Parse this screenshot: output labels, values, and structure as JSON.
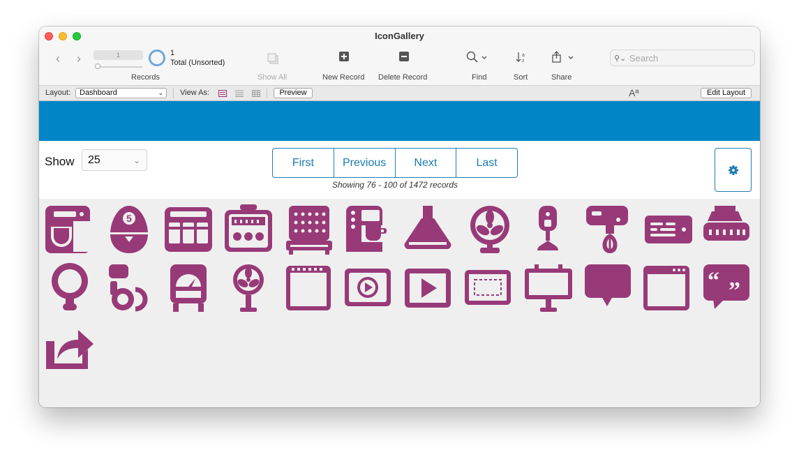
{
  "window": {
    "title": "IconGallery"
  },
  "toolbar": {
    "records_field_value": "1",
    "record_count": "1",
    "record_total": "Total (Unsorted)",
    "records_label": "Records",
    "show_all_label": "Show All",
    "new_record_label": "New Record",
    "delete_record_label": "Delete Record",
    "find_label": "Find",
    "sort_label": "Sort",
    "share_label": "Share",
    "search_placeholder": "Search"
  },
  "layout_bar": {
    "layout_label": "Layout:",
    "layout_value": "Dashboard",
    "view_as_label": "View As:",
    "preview_label": "Preview",
    "text_size_glyph": "Aª",
    "edit_layout_label": "Edit Layout"
  },
  "controls": {
    "show_label": "Show",
    "show_value": "25",
    "pager": {
      "first": "First",
      "previous": "Previous",
      "next": "Next",
      "last": "Last"
    },
    "showing_text": "Showing 76 - 100 of 1472 records"
  },
  "colors": {
    "banner": "#0086c6",
    "icon": "#983a78",
    "accent": "#1a7bb0"
  },
  "icons": [
    "stand-mixer-icon",
    "egg-timer-icon",
    "toaster-oven-icon",
    "oven-icon",
    "grill-icon",
    "coffee-machine-icon",
    "range-hood-icon",
    "desk-fan-icon",
    "stand-blender-icon",
    "hand-mixer-icon",
    "radio-icon",
    "air-purifier-icon",
    "light-bulb-icon",
    "wheelchair-icon",
    "gauge-robot-icon",
    "floor-fan-icon",
    "browser-window-icon",
    "video-player-icon",
    "play-screen-icon",
    "dashed-frame-icon",
    "billboard-icon",
    "speech-bubble-icon",
    "app-window-icon",
    "quote-bubble-icon",
    "share-arrow-icon"
  ]
}
